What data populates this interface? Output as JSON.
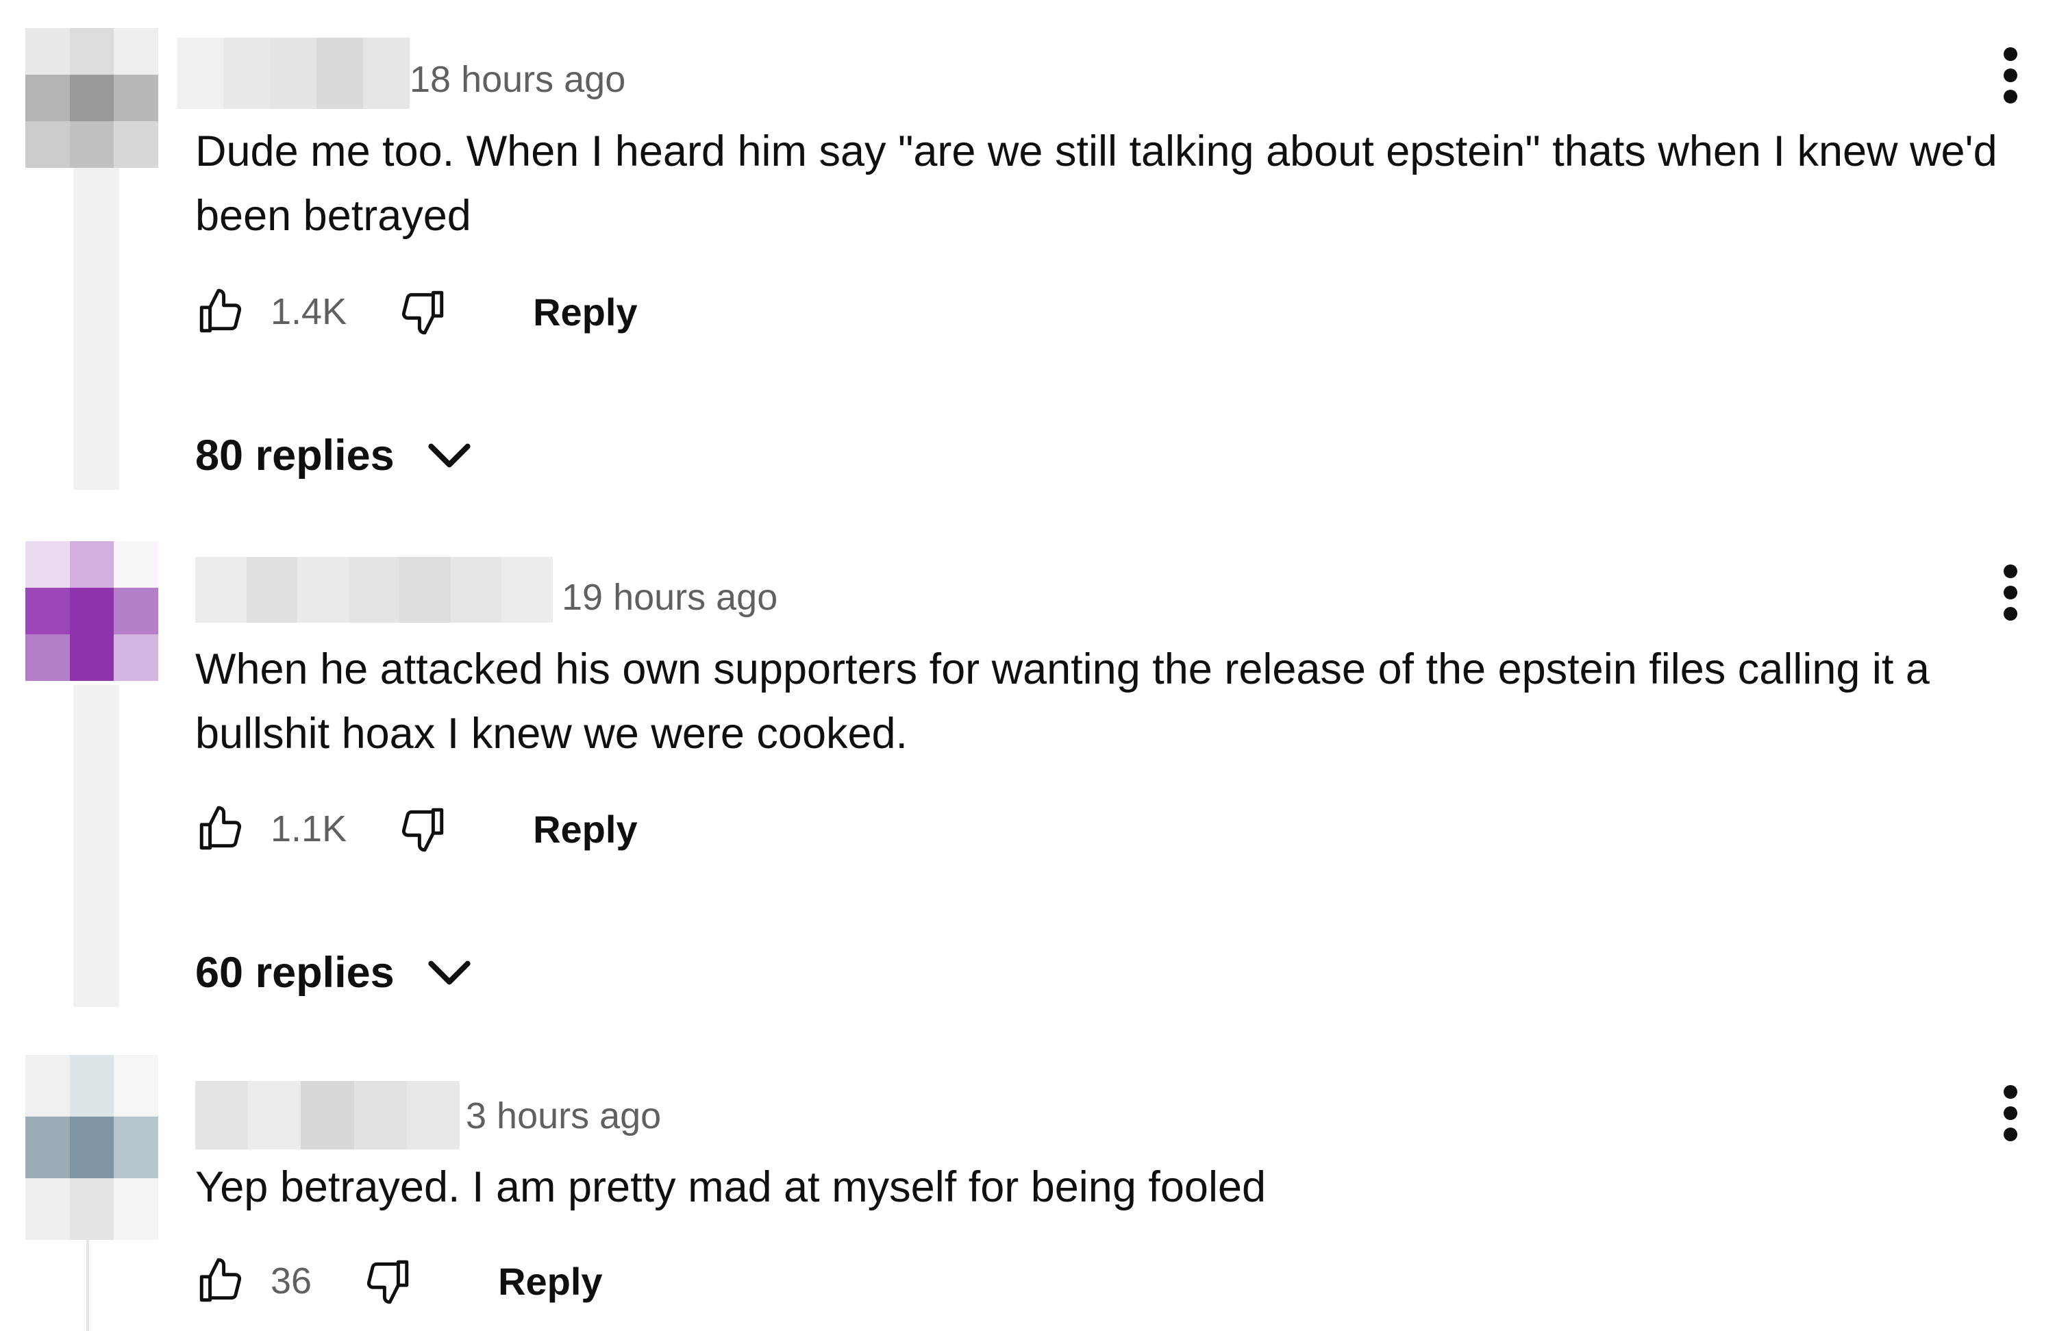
{
  "comments": [
    {
      "timestamp": "18 hours ago",
      "text": "Dude me too. When I heard him say \"are we still talking about epstein\" thats when I knew we'd been betrayed",
      "likes": "1.4K",
      "reply_label": "Reply",
      "replies_label": "80 replies",
      "avatar_colors": [
        "#e8e8e8",
        "#dcdcdc",
        "#eeeeee",
        "#b4b4b4",
        "#999999",
        "#b8b8b8",
        "#cccccc",
        "#c0c0c0",
        "#d8d8d8"
      ]
    },
    {
      "timestamp": "19 hours ago",
      "text": "When he attacked his own supporters for wanting the release of the epstein files calling it a bullshit hoax I knew we were cooked.",
      "likes": "1.1K",
      "reply_label": "Reply",
      "replies_label": "60 replies",
      "avatar_colors": [
        "#eadcf0",
        "#d2aedf",
        "#faf5fb",
        "#9a46b6",
        "#8e33ac",
        "#b47ec8",
        "#b47ec8",
        "#8e33ac",
        "#d6b4e2"
      ]
    },
    {
      "timestamp": "3 hours ago",
      "text": "Yep betrayed. I am pretty mad at myself for being fooled",
      "likes": "36",
      "reply_label": "Reply",
      "avatar_colors": [
        "#f0f0f0",
        "#dde4e8",
        "#f6f6f6",
        "#9aadb8",
        "#7f97a4",
        "#b7c5cd",
        "#eeeeee",
        "#e3e3e3",
        "#f4f4f4"
      ]
    }
  ],
  "icons": {
    "like": "thumbs-up-icon",
    "dislike": "thumbs-down-icon",
    "expand": "chevron-down-icon",
    "menu": "more-vertical-icon"
  }
}
